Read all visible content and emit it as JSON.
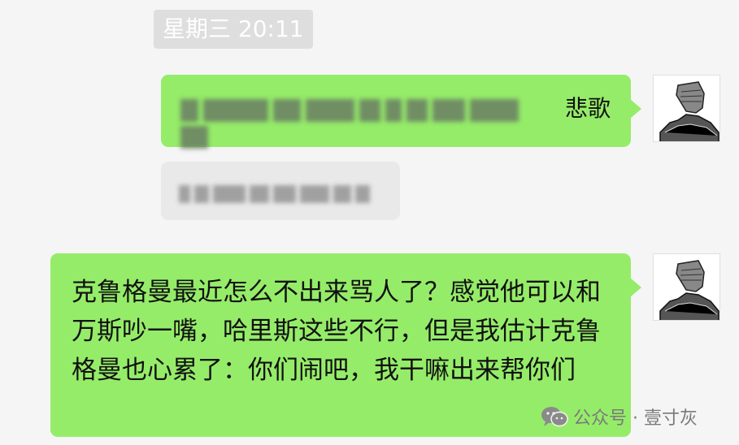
{
  "timestamp": "星期三 20:11",
  "messages": [
    {
      "side": "right",
      "color": "green",
      "visible_text": "悲歌",
      "note_blurred": true
    },
    {
      "side": "right",
      "color": "gray",
      "note_blurred": true
    },
    {
      "side": "right",
      "color": "green",
      "text": "克鲁格曼最近怎么不出来骂人了？感觉他可以和万斯吵一嘴，哈里斯这些不行，但是我估计克鲁格曼也心累了：你们闹吧，我干嘛出来帮你们"
    }
  ],
  "watermark": {
    "label": "公众号 · 壹寸灰",
    "icon": "wechat-icon"
  },
  "colors": {
    "background": "#f5f5f5",
    "green_bubble": "#95ec69",
    "gray_bubble": "#e9e9e9",
    "timestamp_bg": "#dedede"
  }
}
